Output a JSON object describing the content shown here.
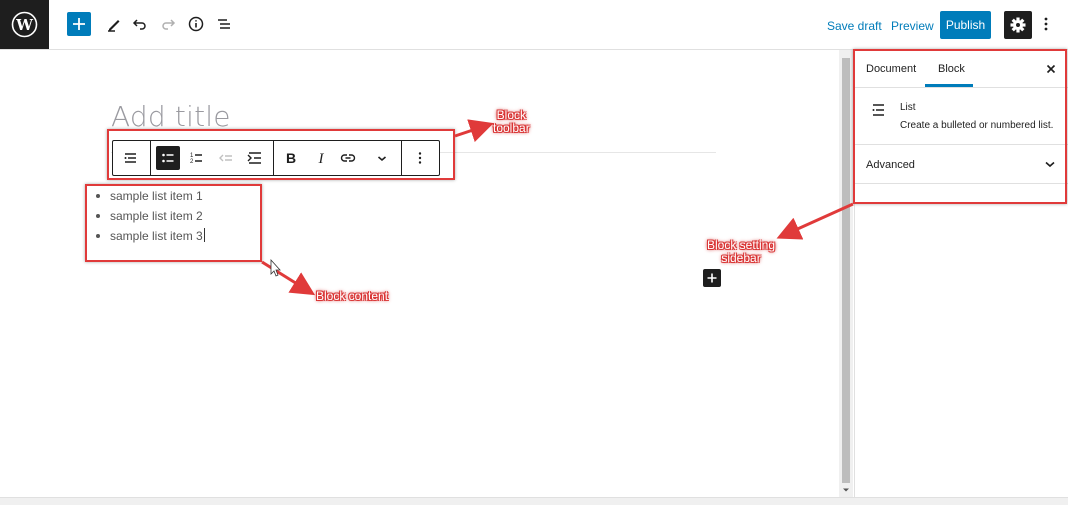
{
  "topbar": {
    "save_draft": "Save draft",
    "preview": "Preview",
    "publish": "Publish"
  },
  "editor": {
    "title_placeholder": "Add title",
    "list_items": [
      "sample list item 1",
      "sample list item 2",
      "sample list item 3"
    ]
  },
  "sidebar": {
    "tabs": [
      "Document",
      "Block"
    ],
    "active_tab": "Block",
    "block_name": "List",
    "block_description": "Create a bulleted or numbered list.",
    "advanced_label": "Advanced"
  },
  "annotations": {
    "toolbar_label": [
      "Block",
      "toolbar"
    ],
    "content_label": "Block content",
    "sidebar_label": [
      "Block setting",
      "sidebar"
    ]
  },
  "colors": {
    "accent": "#007cba",
    "dark": "#1e1e1e",
    "annotation": "#e03a3a"
  }
}
